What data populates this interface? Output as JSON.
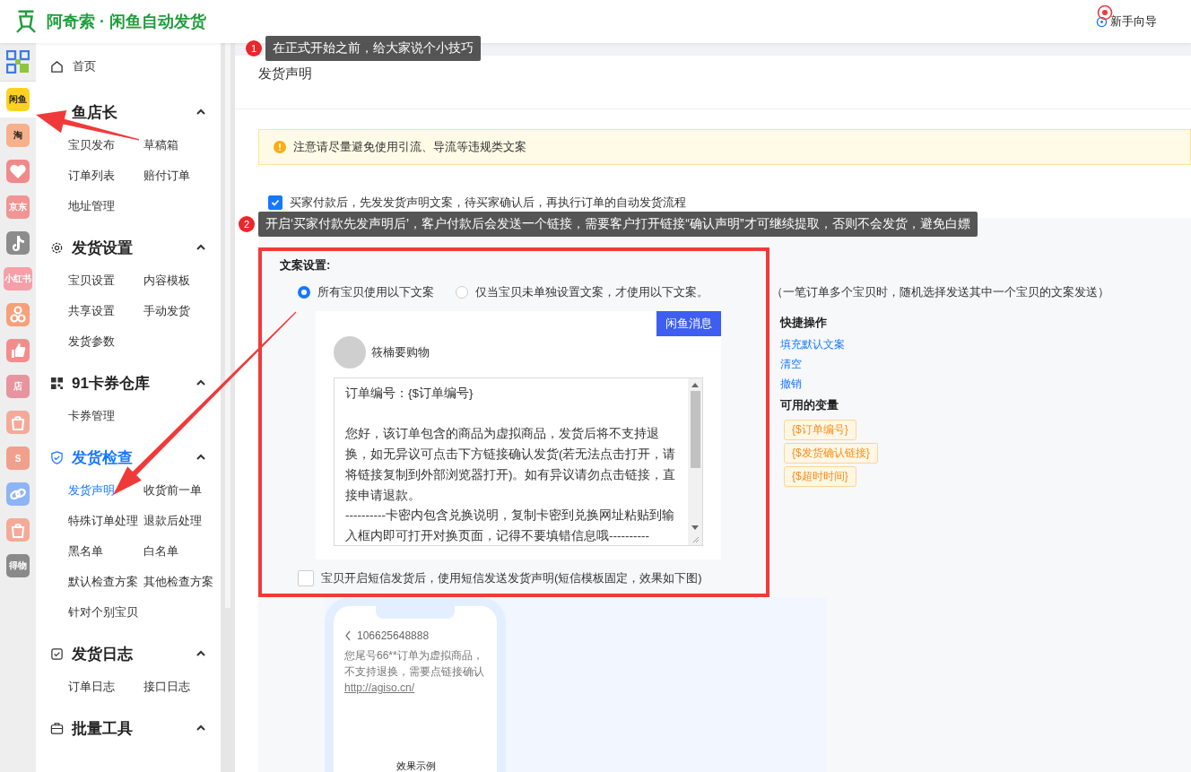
{
  "header": {
    "title": "阿奇索 · 闲鱼自动发货",
    "guide": "新手向导"
  },
  "rail": [
    {
      "kind": "grid",
      "selected": false
    },
    {
      "kind": "text",
      "label": "闲鱼",
      "color": "#ffd21f",
      "selected": true
    },
    {
      "kind": "text",
      "label": "淘",
      "color": "#f6b08c",
      "selected": false
    },
    {
      "kind": "heart",
      "color": "#f08a8a",
      "selected": false
    },
    {
      "kind": "text",
      "label": "京东",
      "color": "#f09494",
      "selected": false
    },
    {
      "kind": "note",
      "color": "#8c8c8c",
      "selected": false
    },
    {
      "kind": "text",
      "label": "小红书",
      "color": "#f5a0a8",
      "selected": false
    },
    {
      "kind": "circles",
      "color": "#f7a07a",
      "selected": false
    },
    {
      "kind": "thumb",
      "color": "#f58c8c",
      "selected": false
    },
    {
      "kind": "text",
      "label": "店",
      "color": "#e8949e",
      "selected": false
    },
    {
      "kind": "bag",
      "color": "#f4aa98",
      "selected": false
    },
    {
      "kind": "text",
      "label": "S",
      "color": "#f0a08c",
      "selected": false
    },
    {
      "kind": "link",
      "color": "#8fb4f5",
      "selected": false
    },
    {
      "kind": "bag",
      "color": "#f4aa98",
      "selected": false
    },
    {
      "kind": "text",
      "label": "得物",
      "color": "#8a8a8a",
      "selected": false
    }
  ],
  "menu": {
    "home": "首页",
    "groups": [
      {
        "title": "鱼店长",
        "expanded": true,
        "active": false,
        "items": [
          {
            "label": "宝贝发布",
            "selected": false
          },
          {
            "label": "草稿箱",
            "selected": false
          },
          {
            "label": "订单列表",
            "selected": false
          },
          {
            "label": "赔付订单",
            "selected": false
          },
          {
            "label": "地址管理",
            "selected": false
          }
        ]
      },
      {
        "title": "发货设置",
        "expanded": true,
        "active": false,
        "items": [
          {
            "label": "宝贝设置",
            "selected": false
          },
          {
            "label": "内容模板",
            "selected": false
          },
          {
            "label": "共享设置",
            "selected": false
          },
          {
            "label": "手动发货",
            "selected": false
          },
          {
            "label": "发货参数",
            "selected": false
          }
        ]
      },
      {
        "title": "91卡券仓库",
        "expanded": true,
        "active": false,
        "items": [
          {
            "label": "卡券管理",
            "selected": false
          }
        ]
      },
      {
        "title": "发货检查",
        "expanded": true,
        "active": true,
        "items": [
          {
            "label": "发货声明",
            "selected": true
          },
          {
            "label": "收货前一单",
            "selected": false
          },
          {
            "label": "特殊订单处理",
            "selected": false
          },
          {
            "label": "退款后处理",
            "selected": false
          },
          {
            "label": "黑名单",
            "selected": false
          },
          {
            "label": "白名单",
            "selected": false
          },
          {
            "label": "默认检查方案",
            "selected": false
          },
          {
            "label": "其他检查方案",
            "selected": false
          },
          {
            "label": "针对个别宝贝",
            "selected": false
          }
        ]
      },
      {
        "title": "发货日志",
        "expanded": true,
        "active": false,
        "items": [
          {
            "label": "订单日志",
            "selected": false
          },
          {
            "label": "接口日志",
            "selected": false
          }
        ]
      },
      {
        "title": "批量工具",
        "expanded": true,
        "active": false
      }
    ]
  },
  "page": {
    "title": "发货声明",
    "alert": "注意请尽量避免使用引流、导流等违规类文案",
    "confirm_checkbox": {
      "label": "买家付款后，先发发货声明文案，待买家确认后，再执行订单的自动发货流程",
      "checked": true
    },
    "panel": {
      "section_label": "文案设置:",
      "radios": [
        {
          "label": "所有宝贝使用以下文案",
          "selected": true
        },
        {
          "label": "仅当宝贝未单独设置文案，才使用以下文案。",
          "selected": false
        }
      ],
      "radio_note": "（一笔订单多个宝贝时，随机选择发送其中一个宝贝的文案发送）",
      "preview": {
        "tag_button": "闲鱼消息",
        "sender": "筱楠要购物",
        "message": "订单编号：{$订单编号}\n\n您好，该订单包含的商品为虚拟商品，发货后将不支持退换，如无异议可点击下方链接确认发货(若无法点击打开，请将链接复制到外部浏览器打开)。如有异议请勿点击链接，直接申请退款。\n----------卡密内包含兑换说明，复制卡密到兑换网址粘贴到输入框内即可打开对换页面，记得不要填错信息哦----------"
      },
      "quick_actions": {
        "title": "快捷操作",
        "links": [
          "填充默认文案",
          "清空",
          "撤销"
        ]
      },
      "variables": {
        "title": "可用的变量",
        "tags": [
          "{$订单编号}",
          "{$发货确认链接}",
          "{$超时时间}"
        ]
      },
      "sms_checkbox": {
        "label": "宝贝开启短信发货后，使用短信发送发货声明(短信模板固定，效果如下图)",
        "checked": false
      },
      "phone": {
        "number": "106625648888",
        "message": "您尾号66**订单为虚拟商品，不支持退换，需要点链接确认",
        "link": "http://agiso.cn/",
        "caption": "效果示例"
      }
    }
  },
  "callouts": [
    {
      "number": "1",
      "text": "在正式开始之前，给大家说个小技巧"
    },
    {
      "number": "2",
      "text": "开启‘买家付款先发声明后’，客户付款后会发送一个链接，需要客户打开链接“确认声明”才可继续提取，否则不会发货，避免白嫖"
    }
  ]
}
